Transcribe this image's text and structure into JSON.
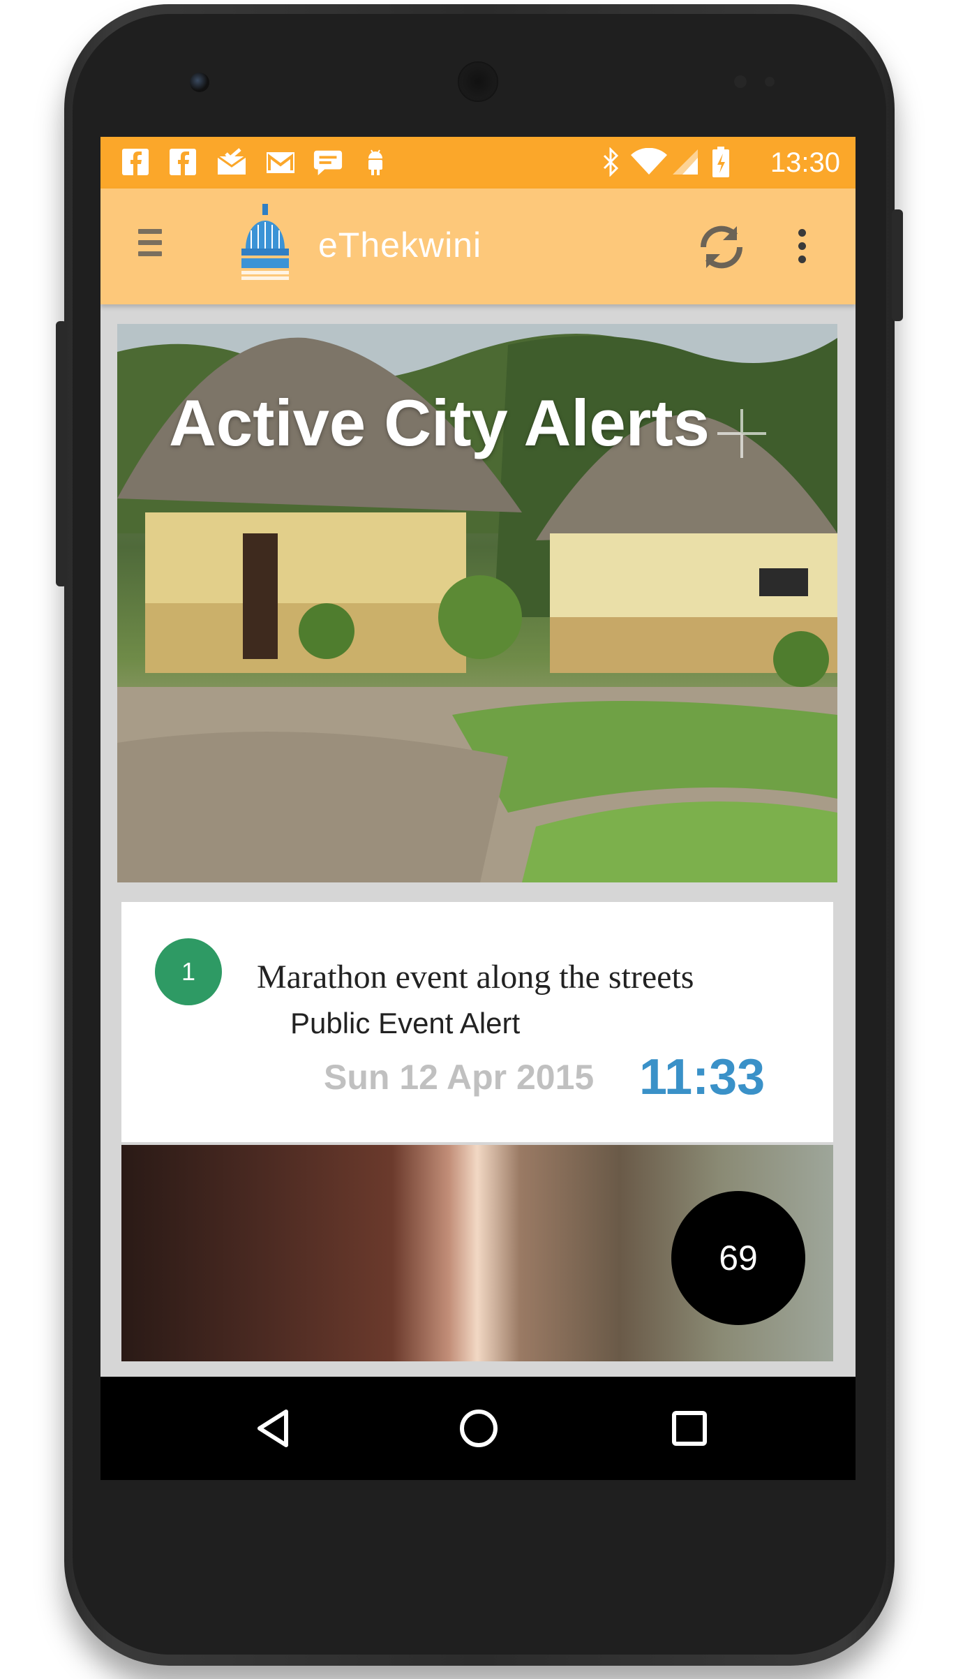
{
  "status_bar": {
    "left_icons": [
      "facebook-icon",
      "facebook-icon",
      "mail-check-icon",
      "gmail-icon",
      "chat-icon",
      "android-icon"
    ],
    "right_icons": [
      "bluetooth-icon",
      "wifi-icon",
      "signal-icon",
      "battery-charging-icon"
    ],
    "time": "13:30"
  },
  "app_bar": {
    "title": "eThekwini",
    "logo": "ethekwini-municipality-logo",
    "actions": [
      "refresh-icon",
      "overflow-menu-icon"
    ]
  },
  "hero": {
    "title": "Active City Alerts",
    "action_icon": "add-icon"
  },
  "alerts": [
    {
      "number": "1",
      "title": "Marathon event along the streets",
      "type": "Public Event Alert",
      "date": "Sun 12 Apr 2015",
      "time": "11:33"
    }
  ],
  "counter": "69",
  "colors": {
    "status_bar": "#fba72a",
    "app_bar": "#fdc87a",
    "badge": "#2e9a64",
    "time_accent": "#3a91c8"
  },
  "nav_bar": [
    "back-icon",
    "home-icon",
    "recents-icon"
  ]
}
